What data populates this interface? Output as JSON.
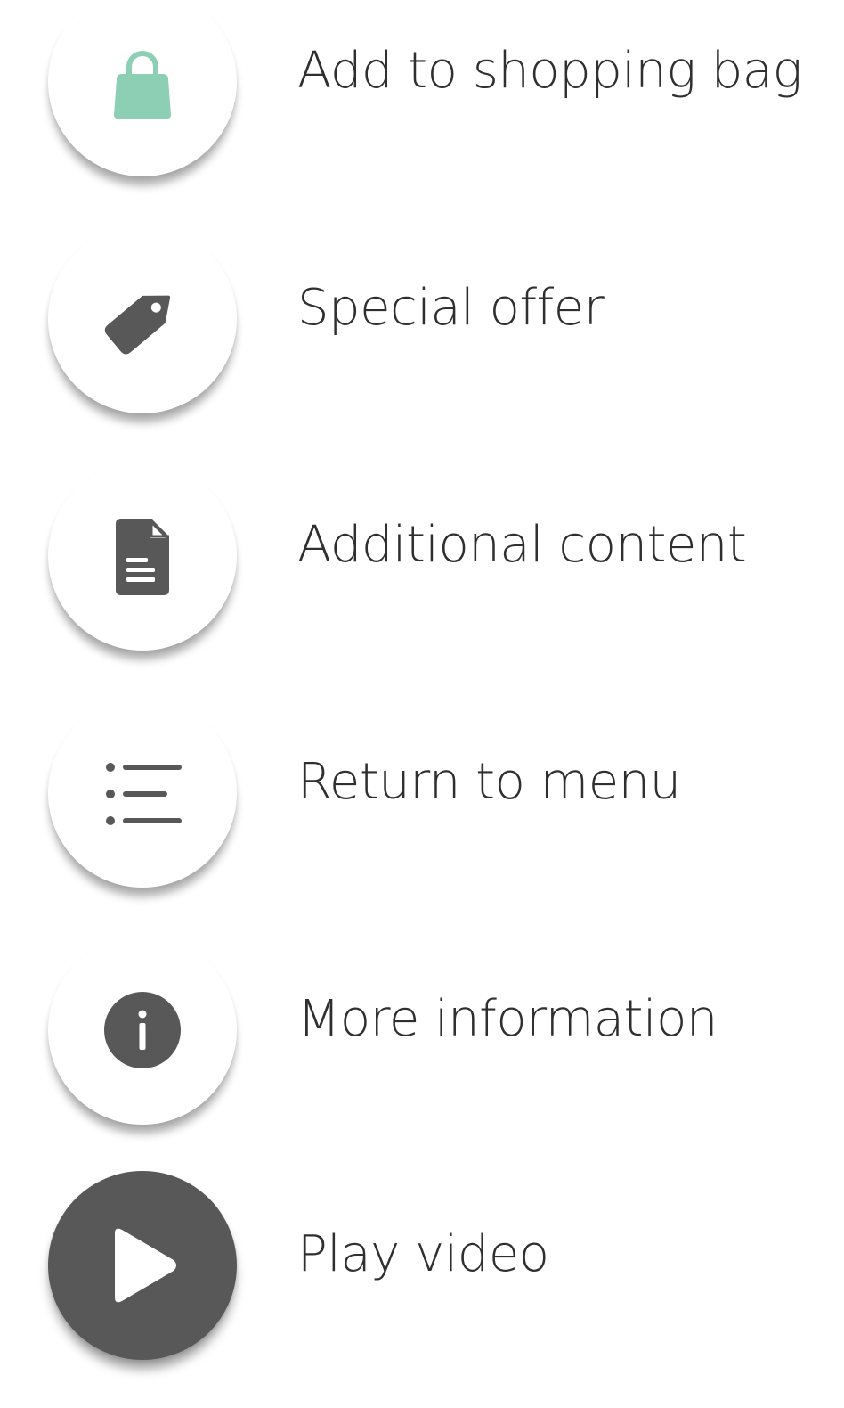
{
  "menu": {
    "items": [
      {
        "label": "Add to shopping bag",
        "icon": "shopping-bag-icon",
        "icon_color": "#8ccfb4"
      },
      {
        "label": "Special offer",
        "icon": "tag-icon",
        "icon_color": "#585858"
      },
      {
        "label": "Additional content",
        "icon": "document-icon",
        "icon_color": "#585858"
      },
      {
        "label": "Return to menu",
        "icon": "list-icon",
        "icon_color": "#585858"
      },
      {
        "label": "More information",
        "icon": "info-icon",
        "icon_color": "#585858"
      },
      {
        "label": "Play video",
        "icon": "play-icon",
        "icon_color": "#ffffff"
      }
    ]
  },
  "colors": {
    "accent_mint": "#8ccfb4",
    "icon_gray": "#585858",
    "text": "#2f2f2f",
    "background": "#ffffff"
  }
}
